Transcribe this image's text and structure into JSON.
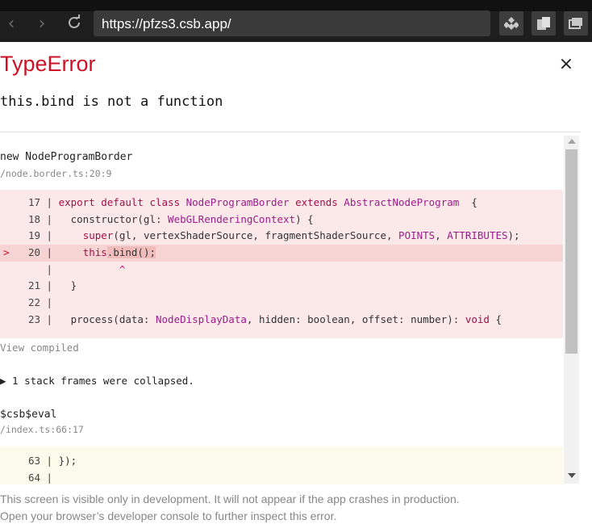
{
  "browser": {
    "url": "https://pfzs3.csb.app/",
    "icons": [
      "back-icon",
      "forward-icon",
      "reload-icon",
      "extension-icon",
      "sidebar-icon",
      "windows-icon"
    ]
  },
  "error": {
    "title": "TypeError",
    "message": "this.bind is not a function",
    "close_label": "×"
  },
  "frames": [
    {
      "function": "new NodeProgramBorder",
      "location": "/node.border.ts:20:9",
      "lines": [
        {
          "num": "17",
          "marker": "",
          "parts": [
            [
              "kw",
              "export default class "
            ],
            [
              "ty",
              "NodeProgramBorder"
            ],
            [
              "kw",
              " extends "
            ],
            [
              "ty",
              "AbstractNodeProgram"
            ],
            [
              "",
              "  {"
            ]
          ]
        },
        {
          "num": "18",
          "marker": "",
          "parts": [
            [
              "",
              "  constructor(gl: "
            ],
            [
              "ty",
              "WebGLRenderingContext"
            ],
            [
              "",
              ") {"
            ]
          ]
        },
        {
          "num": "19",
          "marker": "",
          "parts": [
            [
              "",
              "    "
            ],
            [
              "kw",
              "super"
            ],
            [
              "",
              "(gl, vertexShaderSource, fragmentShaderSource, "
            ],
            [
              "ty",
              "POINTS"
            ],
            [
              "",
              ", "
            ],
            [
              "ty",
              "ATTRIBUTES"
            ],
            [
              "",
              ");"
            ]
          ]
        },
        {
          "num": "20",
          "marker": ">",
          "parts": [
            [
              "",
              "    "
            ],
            [
              "kw",
              "this"
            ],
            [
              "",
              ".bind();"
            ]
          ]
        },
        {
          "num": "",
          "marker": "",
          "parts": [
            [
              "",
              "          "
            ],
            [
              "caret",
              "^"
            ]
          ]
        },
        {
          "num": "21",
          "marker": "",
          "parts": [
            [
              "",
              "  }"
            ]
          ]
        },
        {
          "num": "22",
          "marker": "",
          "parts": [
            [
              "",
              ""
            ]
          ]
        },
        {
          "num": "23",
          "marker": "",
          "parts": [
            [
              "",
              "  process(data: "
            ],
            [
              "ty",
              "NodeDisplayData"
            ],
            [
              "",
              ", hidden: boolean, offset: number): "
            ],
            [
              "kw",
              "void"
            ],
            [
              "",
              " {"
            ]
          ]
        }
      ]
    },
    {
      "function": "$csb$eval",
      "location": "/index.ts:66:17",
      "lines": [
        {
          "num": "63",
          "marker": "",
          "parts": [
            [
              "",
              "});"
            ]
          ]
        },
        {
          "num": "64",
          "marker": "",
          "parts": [
            [
              "",
              ""
            ]
          ]
        }
      ]
    }
  ],
  "view_compiled": "View compiled",
  "collapsed": "▶ 1 stack frames were collapsed.",
  "footer": {
    "line1": "This screen is visible only in development. It will not appear if the app crashes in production.",
    "line2": "Open your browser’s developer console to further inspect this error."
  },
  "colors": {
    "title": "#ce1126",
    "error_bg": "#fbe9ea",
    "ok_bg": "#fcfaea"
  }
}
